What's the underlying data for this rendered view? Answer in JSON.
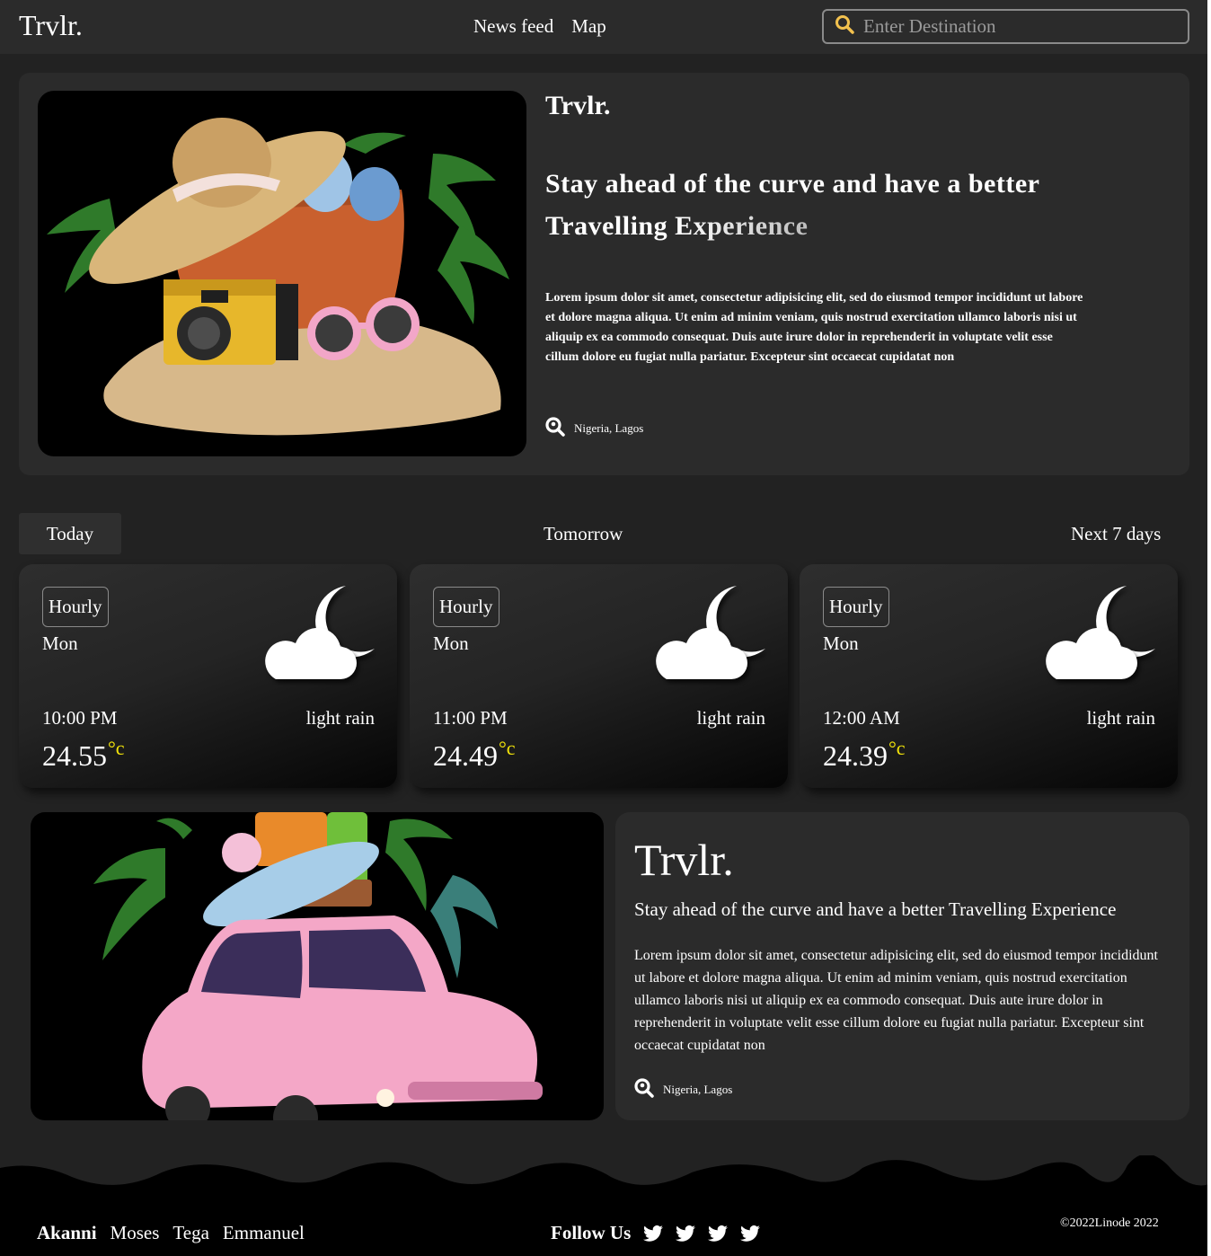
{
  "nav": {
    "brand": "Trvlr.",
    "links": [
      "News feed",
      "Map"
    ],
    "search_placeholder": "Enter Destination"
  },
  "hero": {
    "brand": "Trvlr.",
    "headline_line1": "Stay ahead of the curve and have a better",
    "headline_line2a": "Travelling ",
    "headline_line2b": "Experience",
    "body": "Lorem ipsum dolor sit amet, consectetur adipisicing elit, sed do eiusmod tempor incididunt ut labore et dolore magna aliqua. Ut enim ad minim veniam, quis nostrud exercitation ullamco laboris nisi ut aliquip ex ea commodo consequat. Duis aute irure dolor in reprehenderit in voluptate velit esse cillum dolore eu fugiat nulla pariatur. Excepteur sint occaecat cupidatat non",
    "location": "Nigeria, Lagos"
  },
  "tabs": [
    "Today",
    "Tomorrow",
    "Next 7 days"
  ],
  "weather": [
    {
      "button": "Hourly",
      "day": "Mon",
      "time": "10:00 PM",
      "desc": "light rain",
      "temp": "24.55",
      "unit": "°c"
    },
    {
      "button": "Hourly",
      "day": "Mon",
      "time": "11:00 PM",
      "desc": "light rain",
      "temp": "24.49",
      "unit": "°c"
    },
    {
      "button": "Hourly",
      "day": "Mon",
      "time": "12:00 AM",
      "desc": "light rain",
      "temp": "24.39",
      "unit": "°c"
    }
  ],
  "feature": {
    "brand": "Trvlr.",
    "headline": "Stay ahead of the curve and have a better Travelling Experience",
    "body": "Lorem ipsum dolor sit amet, consectetur adipisicing elit, sed do eiusmod tempor incididunt ut labore et dolore magna aliqua. Ut enim ad minim veniam, quis nostrud exercitation ullamco laboris nisi ut aliquip ex ea commodo consequat. Duis aute irure dolor in reprehenderit in voluptate velit esse cillum dolore eu fugiat nulla pariatur. Excepteur sint occaecat cupidatat non",
    "location": "Nigeria, Lagos"
  },
  "footer": {
    "names": [
      "Akanni",
      "Moses",
      "Tega",
      "Emmanuel"
    ],
    "follow_label": "Follow Us",
    "social_icons": [
      "twitter-icon",
      "twitter-icon",
      "twitter-icon",
      "twitter-icon"
    ],
    "copyright": "©2022Linode 2022"
  },
  "colors": {
    "background": "#222222",
    "panel": "#2b2b2b",
    "temp_unit": "#f5e60a",
    "search_icon": "#f2c14e"
  }
}
